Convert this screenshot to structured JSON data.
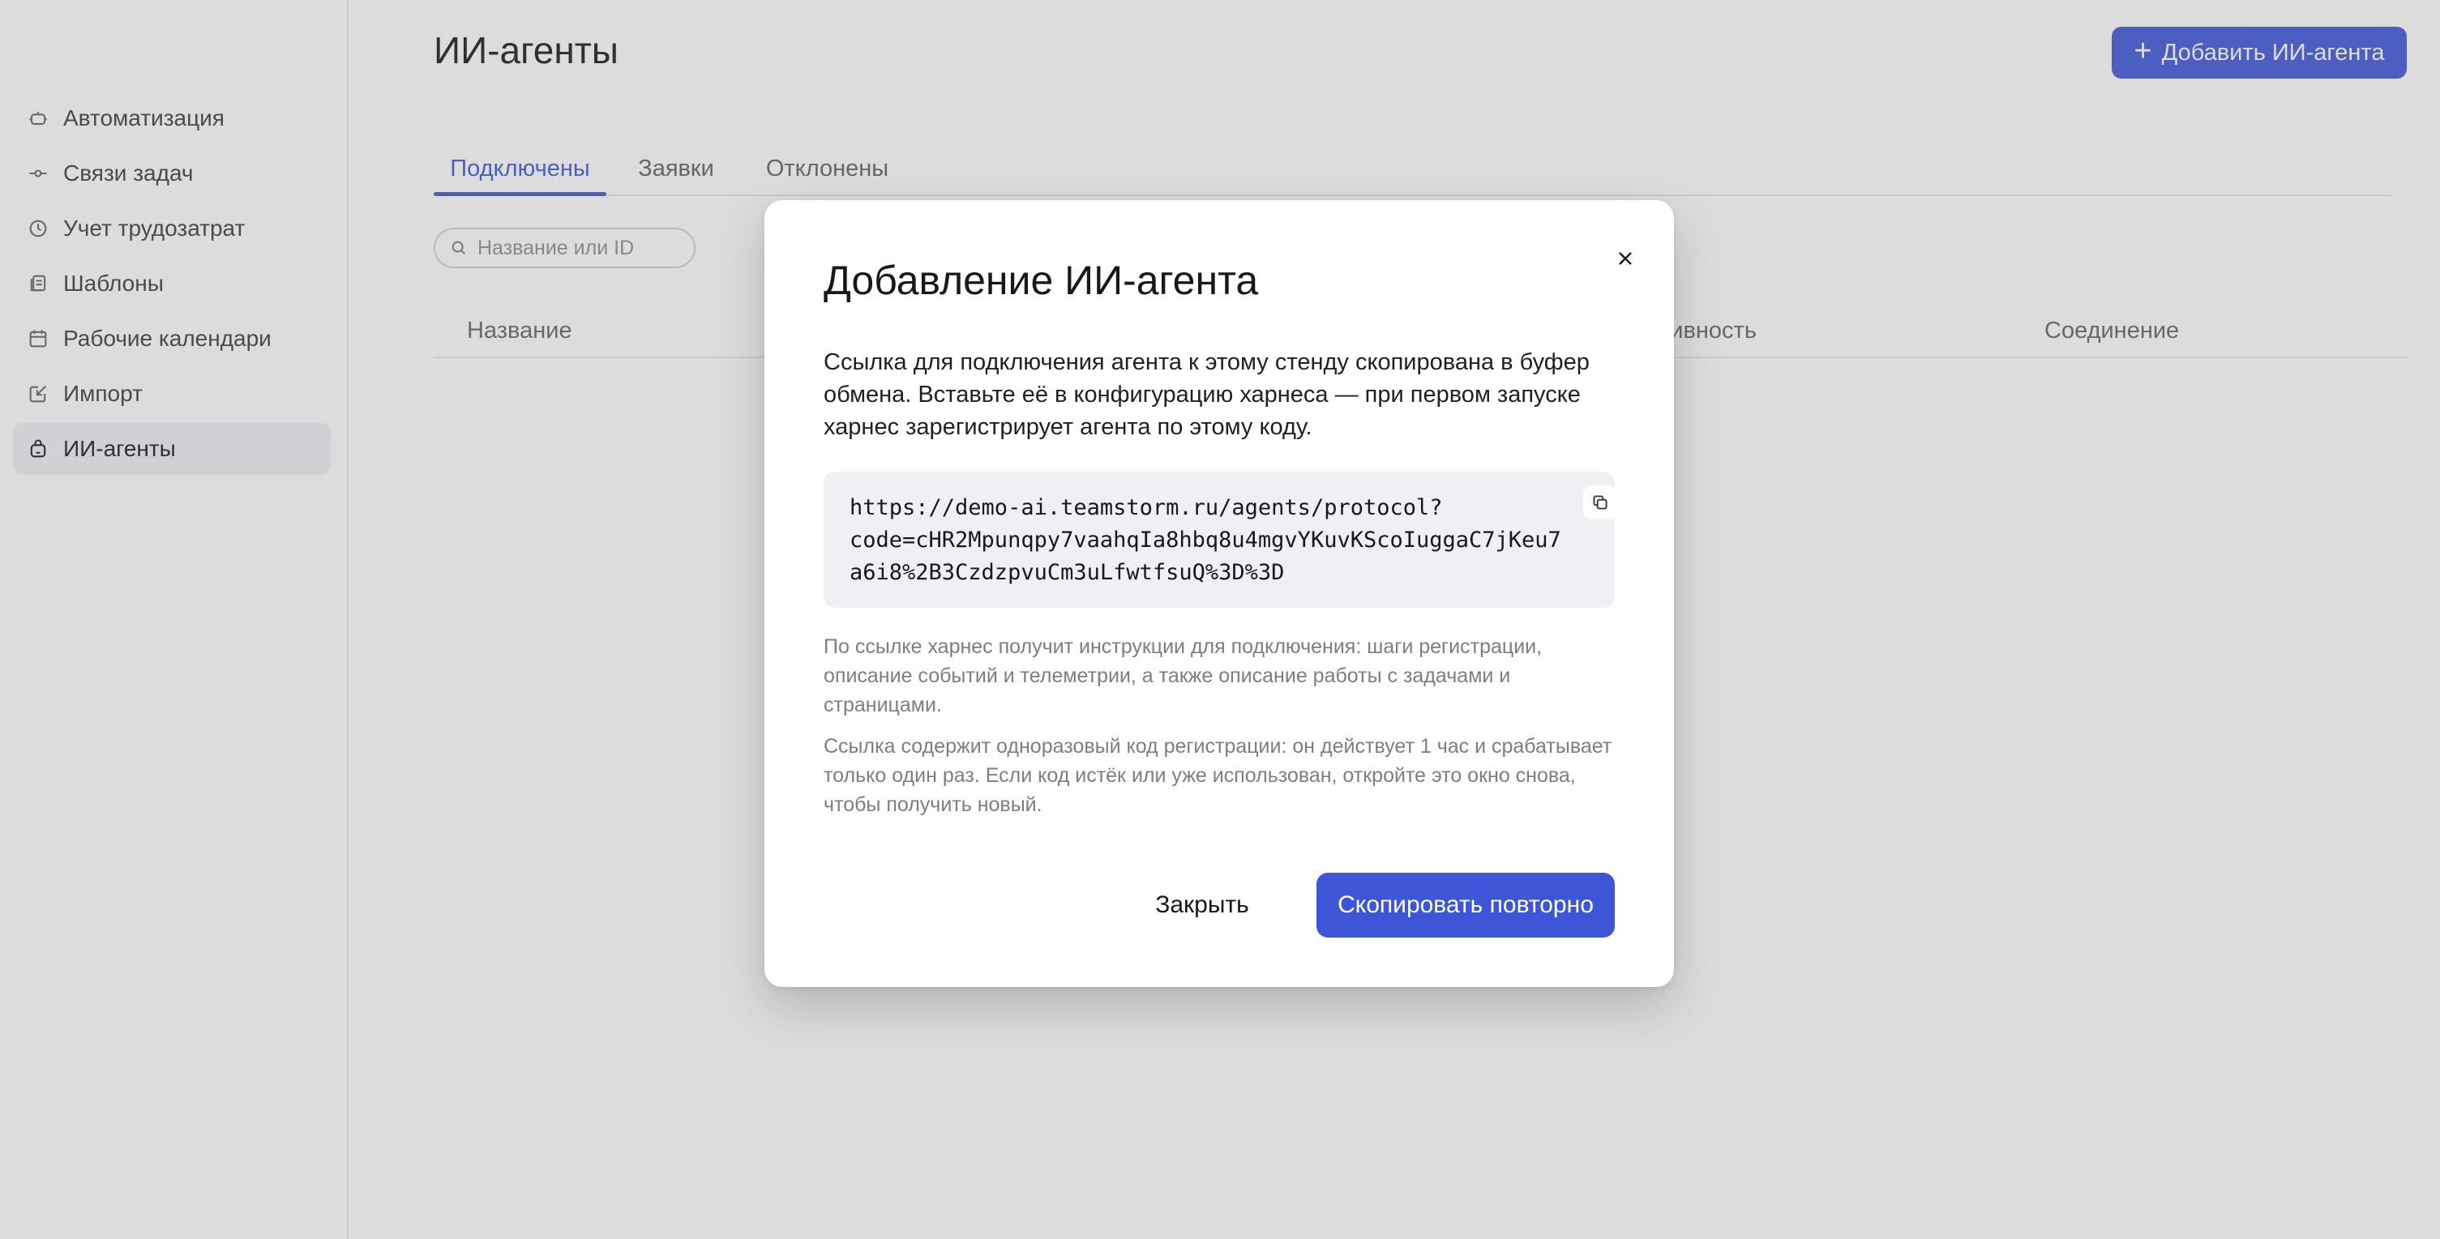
{
  "sidebar": {
    "items": [
      {
        "label": "Автоматизация",
        "icon": "robot-icon"
      },
      {
        "label": "Связи задач",
        "icon": "link-icon"
      },
      {
        "label": "Учет трудозатрат",
        "icon": "clock-icon"
      },
      {
        "label": "Шаблоны",
        "icon": "template-icon"
      },
      {
        "label": "Рабочие календари",
        "icon": "calendar-icon"
      },
      {
        "label": "Импорт",
        "icon": "import-icon"
      },
      {
        "label": "ИИ-агенты",
        "icon": "agent-icon",
        "active": true
      }
    ]
  },
  "page": {
    "title": "ИИ-агенты",
    "add_button_label": "Добавить ИИ-агента"
  },
  "tabs": [
    {
      "label": "Подключены",
      "active": true
    },
    {
      "label": "Заявки",
      "active": false
    },
    {
      "label": "Отклонены",
      "active": false
    }
  ],
  "search": {
    "placeholder": "Название или ID",
    "value": ""
  },
  "table": {
    "columns": [
      "Название",
      "тивность",
      "Соединение"
    ]
  },
  "modal": {
    "title": "Добавление ИИ-агента",
    "description": "Ссылка для подключения агента к этому стенду скопирована в буфер обмена. Вставьте её в конфигурацию харнеса — при первом запуске харнес зарегистрирует агента по этому коду.",
    "link": "https://demo-ai.teamstorm.ru/agents/protocol?\ncode=cHR2Mpunqpy7vaahqIa8hbq8u4mgvYKuvKScoIuggaC7jKeu7\na6i8%2B3CzdzpvuCm3uLfwtfsuQ%3D%3D",
    "note_1": "По ссылке харнес получит инструкции для подключения: шаги регистрации, описание событий и телеметрии, а также описание работы с задачами и страницами.",
    "note_2": "Ссылка содержит одноразовый код регистрации: он действует 1 час и срабатывает только один раз. Если код истёк или уже использован, откройте это окно снова, чтобы получить новый.",
    "close_button_label": "Закрыть",
    "copy_again_button_label": "Скопировать повторно"
  },
  "colors": {
    "accent": "#3d56d8",
    "overlay": "rgba(118, 118, 118, 0.26)"
  }
}
